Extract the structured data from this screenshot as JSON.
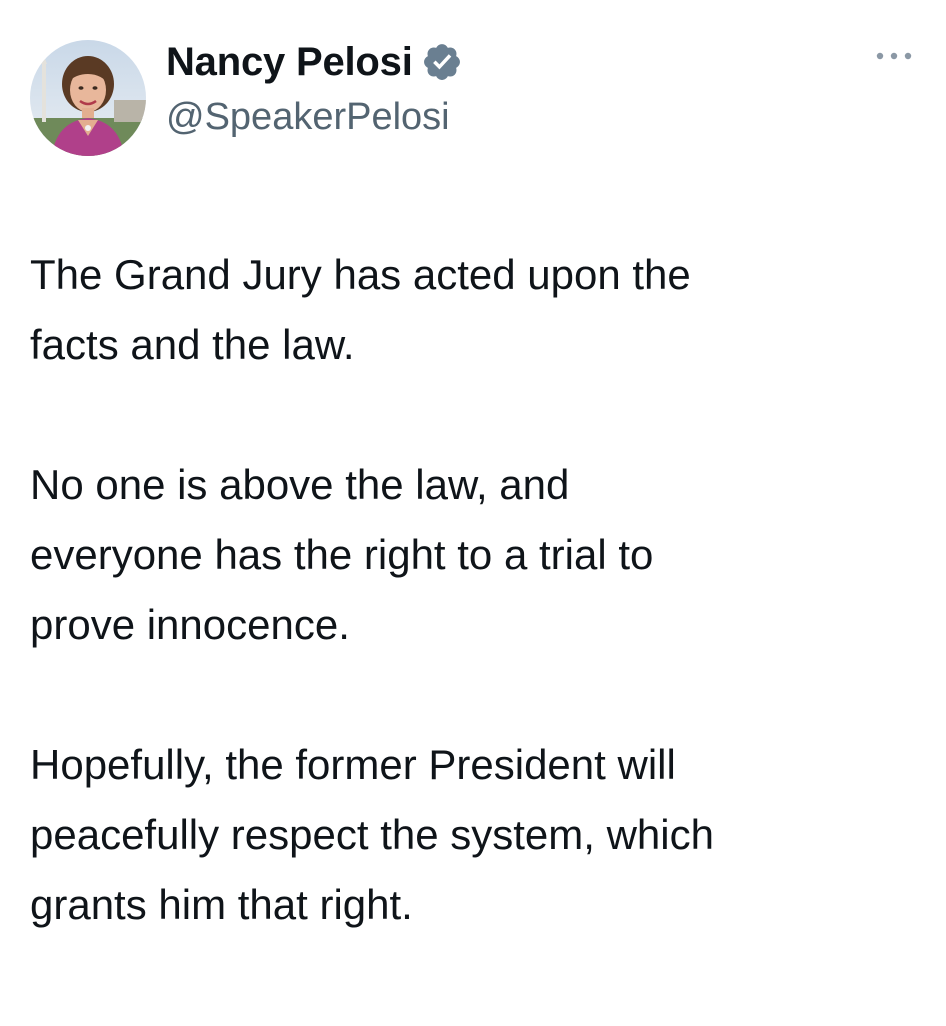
{
  "author": {
    "display_name": "Nancy Pelosi",
    "handle": "@SpeakerPelosi",
    "verified_icon": "verified-badge-icon",
    "avatar_icon": "profile-photo"
  },
  "menu": {
    "more_icon": "more-options-icon"
  },
  "tweet": {
    "paragraphs": [
      "The Grand Jury has acted upon the\nfacts and the law.",
      "No one is above the law, and\neveryone has the right to a trial to\nprove innocence.",
      "Hopefully, the former President will\npeacefully respect the system, which\ngrants him that right."
    ]
  },
  "colors": {
    "text": "#0f1419",
    "secondary": "#536471",
    "verified": "#6a7f91"
  }
}
